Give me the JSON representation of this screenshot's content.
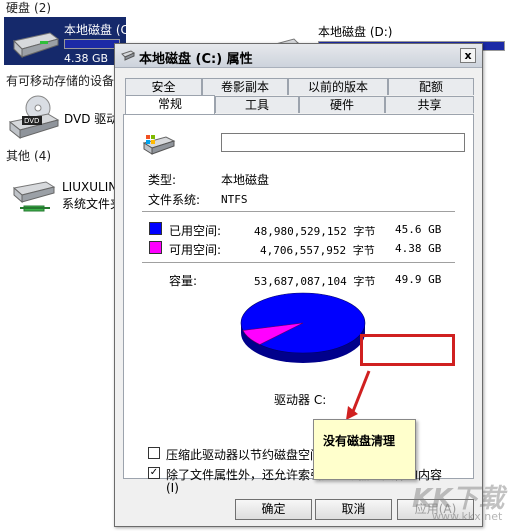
{
  "explorer": {
    "groups": [
      {
        "label": "硬盘",
        "count": "(2)"
      },
      {
        "label": "有可移动存储的设备",
        "count": ""
      },
      {
        "label": "其他",
        "count": "(4)"
      }
    ],
    "drives": {
      "c": {
        "name": "本地磁盘 (C:)",
        "free": "4.38 GB",
        "used_fraction": 0.91
      },
      "d": {
        "name": "本地磁盘 (D:)",
        "used_fraction": 0.88
      },
      "dvd": {
        "name": "DVD 驱动器"
      },
      "net": {
        "name": "LIUXULIN-",
        "sub": "系统文件夹"
      }
    }
  },
  "dialog": {
    "title": "本地磁盘 (C:) 属性",
    "close_label": "x",
    "tabs_back": [
      "安全",
      "卷影副本",
      "以前的版本",
      "配额"
    ],
    "tabs_front": [
      "常规",
      "工具",
      "硬件",
      "共享"
    ],
    "active_tab": "常规",
    "general": {
      "name_value": "",
      "type_label": "类型:",
      "type_value": "本地磁盘",
      "fs_label": "文件系统:",
      "fs_value": "NTFS",
      "used": {
        "label": "已用空间:",
        "bytes": "48,980,529,152 字节",
        "size": "45.6 GB",
        "color": "#0000ff"
      },
      "free": {
        "label": "可用空间:",
        "bytes": "4,706,557,952 字节",
        "size": "4.38 GB",
        "color": "#ff00ff"
      },
      "capacity": {
        "label": "容量:",
        "bytes": "53,687,087,104 字节",
        "size": "49.9 GB"
      },
      "drive_label": "驱动器 C:",
      "compress_label": "压缩此驱动器以节约磁盘空间(C)",
      "compress_checked": false,
      "index_label": "除了文件属性外，还允许索引此驱动器上文件的内容",
      "index_label_line2": "(I)",
      "index_checked": true,
      "check_mark": "✓"
    },
    "buttons": {
      "ok": "确定",
      "cancel": "取消",
      "apply": "应用(A)"
    }
  },
  "annotation": {
    "note": "没有磁盘清理"
  },
  "watermark": {
    "text": "KK下载",
    "url": "www.kkx.net"
  }
}
